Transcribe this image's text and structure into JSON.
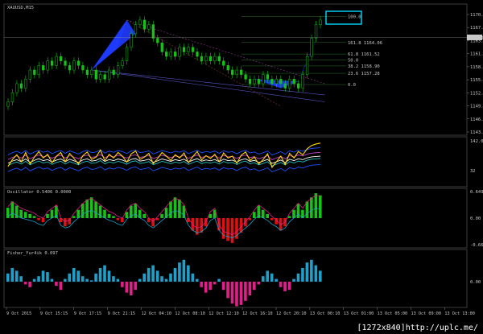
{
  "window_title": "XAUUSD,M15",
  "price_pane": {
    "type": "candlestick",
    "symbol_label": "XAUUSD,M15",
    "y_range": [
      1144.0,
      1172.0
    ],
    "ticks": [
      "1170.00",
      "1167.00",
      "1163.55",
      "1161.10",
      "1158.10",
      "1155.10",
      "1152.10",
      "1149.20",
      "1146.20",
      "1143.30"
    ],
    "current_price_label": "1165.18",
    "fib_levels": [
      {
        "label": "100.0",
        "value": 1169.8
      },
      {
        "label": "161.8 1164.06",
        "value": 1164.06
      },
      {
        "label": "61.8 1161.52",
        "value": 1161.52
      },
      {
        "label": "50.0",
        "value": 1160.2
      },
      {
        "label": "38.2 1158.90",
        "value": 1158.9
      },
      {
        "label": "23.6 1157.28",
        "value": 1157.28
      },
      {
        "label": "0.0",
        "value": 1154.8
      }
    ],
    "close_series": [
      1151,
      1153,
      1155,
      1154,
      1156,
      1158,
      1157,
      1159,
      1158,
      1160,
      1159,
      1161,
      1160,
      1159,
      1158,
      1160,
      1159,
      1158,
      1157,
      1158,
      1156,
      1157,
      1156,
      1158,
      1157,
      1159,
      1160,
      1163,
      1166,
      1168,
      1169,
      1167,
      1168,
      1165,
      1164,
      1162,
      1161,
      1162,
      1161,
      1163,
      1162,
      1163,
      1162,
      1161,
      1160,
      1161,
      1160,
      1161,
      1160,
      1159,
      1158,
      1157,
      1158,
      1157,
      1156,
      1155,
      1156,
      1155,
      1157,
      1156,
      1155,
      1156,
      1155,
      1154,
      1156,
      1155,
      1154,
      1157,
      1161,
      1165,
      1168,
      1169
    ]
  },
  "rsi_pane": {
    "level_label": "32",
    "ticks": [
      "142.00",
      "32"
    ],
    "values": [
      40,
      55,
      65,
      50,
      70,
      45,
      60,
      72,
      58,
      66,
      48,
      62,
      70,
      50,
      68,
      57,
      45,
      63,
      71,
      55,
      60,
      75,
      52,
      66,
      58,
      70,
      62,
      49,
      67,
      73,
      55,
      60,
      68,
      46,
      57,
      70,
      62,
      53,
      65,
      58,
      69,
      48,
      61,
      72,
      54,
      63,
      57,
      66,
      50,
      69,
      58,
      62,
      47,
      64,
      71,
      53,
      60,
      45,
      55,
      67,
      38,
      50,
      62,
      44,
      68,
      58,
      72,
      65,
      78,
      85,
      88,
      90
    ]
  },
  "osc1_pane": {
    "label": "Oscillator 0.5406 0.0000",
    "ticks": [
      "0.6494",
      "0.00",
      "-0.6637"
    ],
    "values": [
      0.25,
      0.4,
      0.3,
      0.2,
      0.15,
      0.1,
      0.05,
      -0.05,
      -0.1,
      0.1,
      0.2,
      0.3,
      -0.1,
      -0.2,
      -0.15,
      0.05,
      0.2,
      0.35,
      0.45,
      0.5,
      0.4,
      0.3,
      0.2,
      0.1,
      0.05,
      -0.05,
      -0.1,
      0.15,
      0.3,
      0.35,
      0.2,
      0.1,
      -0.1,
      -0.2,
      -0.05,
      0.1,
      0.25,
      0.4,
      0.5,
      0.45,
      0.3,
      -0.1,
      -0.3,
      -0.4,
      -0.35,
      -0.2,
      0.1,
      0.2,
      -0.3,
      -0.5,
      -0.55,
      -0.6,
      -0.5,
      -0.35,
      -0.2,
      -0.05,
      0.15,
      0.3,
      0.2,
      0.1,
      -0.05,
      -0.15,
      -0.3,
      -0.2,
      0.05,
      0.2,
      0.35,
      0.2,
      0.4,
      0.5,
      0.6,
      0.55
    ]
  },
  "osc2_pane": {
    "label": "Fisher_Yur4ik 0.097",
    "ticks": [
      "0.00"
    ],
    "values": [
      0.3,
      0.5,
      0.4,
      0.2,
      -0.1,
      -0.2,
      0.1,
      0.2,
      0.4,
      0.35,
      0.1,
      -0.15,
      -0.3,
      0.1,
      0.3,
      0.5,
      0.4,
      0.2,
      0.1,
      0.05,
      0.3,
      0.5,
      0.6,
      0.4,
      0.2,
      0.1,
      -0.2,
      -0.4,
      -0.5,
      -0.3,
      0.1,
      0.3,
      0.5,
      0.6,
      0.4,
      0.2,
      0.1,
      0.3,
      0.5,
      0.7,
      0.8,
      0.6,
      0.3,
      0.1,
      -0.2,
      -0.4,
      -0.3,
      -0.1,
      0.1,
      -0.3,
      -0.6,
      -0.8,
      -0.9,
      -0.85,
      -0.7,
      -0.5,
      -0.3,
      -0.1,
      0.2,
      0.4,
      0.3,
      0.1,
      -0.2,
      -0.35,
      -0.3,
      0.1,
      0.3,
      0.5,
      0.7,
      0.8,
      0.6,
      0.4
    ]
  },
  "x_ticks": [
    "9 Oct 2015",
    "9 Oct 15:15",
    "9 Oct 17:15",
    "9 Oct 21:15",
    "12 Oct 04:10",
    "12 Oct 08:10",
    "12 Oct 12:10",
    "12 Oct 16:10",
    "12 Oct 20:10",
    "13 Oct 00:10",
    "13 Oct 01:00",
    "13 Oct 05:00",
    "13 Oct 09:00",
    "13 Oct 13:00"
  ],
  "watermark": "[1272x840]http://uplc.me/",
  "colors": {
    "bull": "#16c216",
    "bear": "#e01010",
    "pattern": "#1f3bff",
    "highlight_box": "#00d8ff",
    "rsi": "#ffd400",
    "cyan": "#20a0c8",
    "magenta": "#e0208a",
    "grid": "#3a3a3a"
  }
}
